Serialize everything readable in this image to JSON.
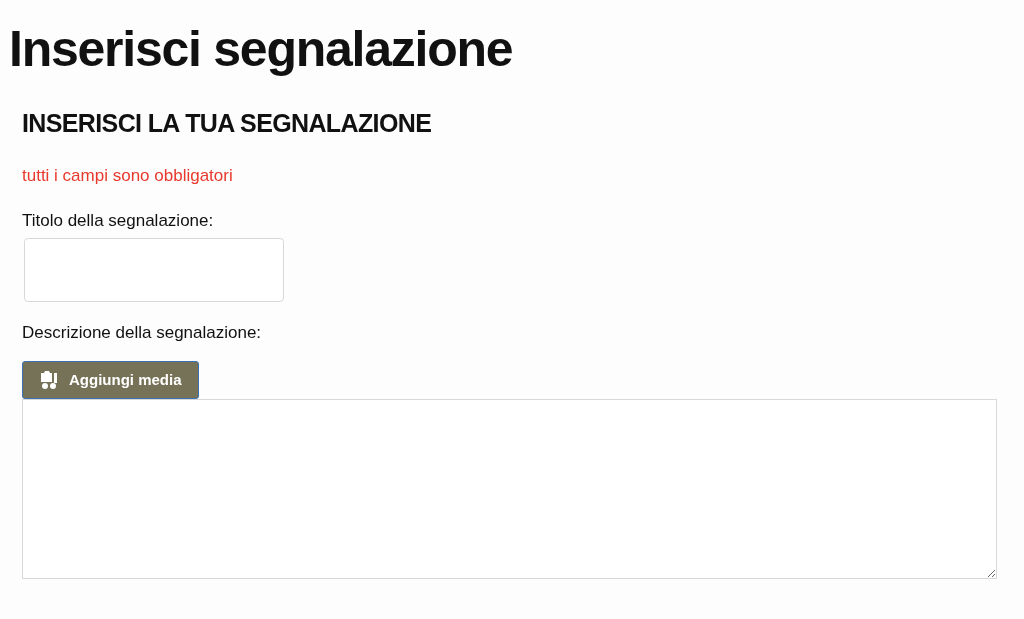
{
  "page_title": "Inserisci segnalazione",
  "form": {
    "heading": "INSERISCI LA TUA SEGNALAZIONE",
    "notice": "tutti i campi sono obbligatori",
    "title_label": "Titolo della segnalazione:",
    "description_label": "Descrizione della segnalazione:",
    "media_button": "Aggiungi media"
  }
}
